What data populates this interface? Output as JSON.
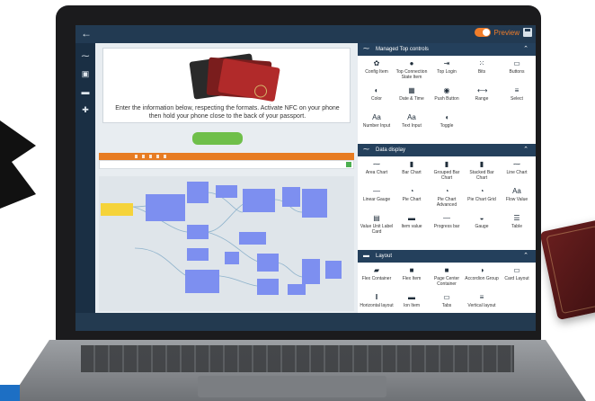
{
  "topbar": {
    "preview_label": "Preview"
  },
  "canvas": {
    "instruction_text": "Enter the information below, respecting the formats. Activate NFC on your phone then hold your phone close to the back of your passport."
  },
  "panel": {
    "sections": [
      {
        "title": "Managed Top controls",
        "items": [
          {
            "label": "Config Item",
            "icon": "gear-icon"
          },
          {
            "label": "Top Connection State Item",
            "icon": "alert-icon"
          },
          {
            "label": "Top Login",
            "icon": "login-icon"
          },
          {
            "label": "Bits",
            "icon": "grid-icon"
          },
          {
            "label": "Buttons",
            "icon": "buttons-icon"
          },
          {
            "label": "Color",
            "icon": "palette-icon"
          },
          {
            "label": "Date & Time",
            "icon": "calendar-icon"
          },
          {
            "label": "Push Button",
            "icon": "push-button-icon"
          },
          {
            "label": "Range",
            "icon": "range-icon"
          },
          {
            "label": "Select",
            "icon": "list-icon"
          },
          {
            "label": "Number Input",
            "icon": "text-aa-icon",
            "glyph": "Aa"
          },
          {
            "label": "Text Input",
            "icon": "text-aa-icon",
            "glyph": "Aa"
          },
          {
            "label": "Toggle",
            "icon": "toggle-icon"
          }
        ]
      },
      {
        "title": "Data display",
        "items": [
          {
            "label": "Area Chart",
            "icon": "area-chart-icon"
          },
          {
            "label": "Bar Chart",
            "icon": "bar-chart-icon"
          },
          {
            "label": "Grouped Bar Chart",
            "icon": "grouped-bar-icon"
          },
          {
            "label": "Stacked Bar Chart",
            "icon": "stacked-bar-icon"
          },
          {
            "label": "Line Chart",
            "icon": "line-chart-icon"
          },
          {
            "label": "Linear Gauge",
            "icon": "linear-gauge-icon"
          },
          {
            "label": "Pie Chart",
            "icon": "pie-chart-icon"
          },
          {
            "label": "Pie Chart Advanced",
            "icon": "pie-chart-icon"
          },
          {
            "label": "Pie Chart Grid",
            "icon": "pie-chart-icon"
          },
          {
            "label": "Flow Value",
            "icon": "text-aa-icon",
            "glyph": "Aa"
          },
          {
            "label": "Value Unit Label Card",
            "icon": "card-icon"
          },
          {
            "label": "Item value",
            "icon": "item-icon"
          },
          {
            "label": "Progress bar",
            "icon": "progress-icon"
          },
          {
            "label": "Gauge",
            "icon": "gauge-icon"
          },
          {
            "label": "Table",
            "icon": "table-icon"
          }
        ]
      },
      {
        "title": "Layout",
        "items": [
          {
            "label": "Flex Container",
            "icon": "folder-icon"
          },
          {
            "label": "Flex Item",
            "icon": "square-icon"
          },
          {
            "label": "Page Center Container",
            "icon": "square-icon"
          },
          {
            "label": "Accordion Group",
            "icon": "chevron-circle-icon"
          },
          {
            "label": "Card Layout",
            "icon": "card-layout-icon"
          },
          {
            "label": "Horizontal layout",
            "icon": "pause-icon"
          },
          {
            "label": "Ion Item",
            "icon": "ion-item-icon"
          },
          {
            "label": "Tabs",
            "icon": "tabs-icon"
          },
          {
            "label": "Vertical layout",
            "icon": "list-icon"
          }
        ]
      }
    ]
  }
}
